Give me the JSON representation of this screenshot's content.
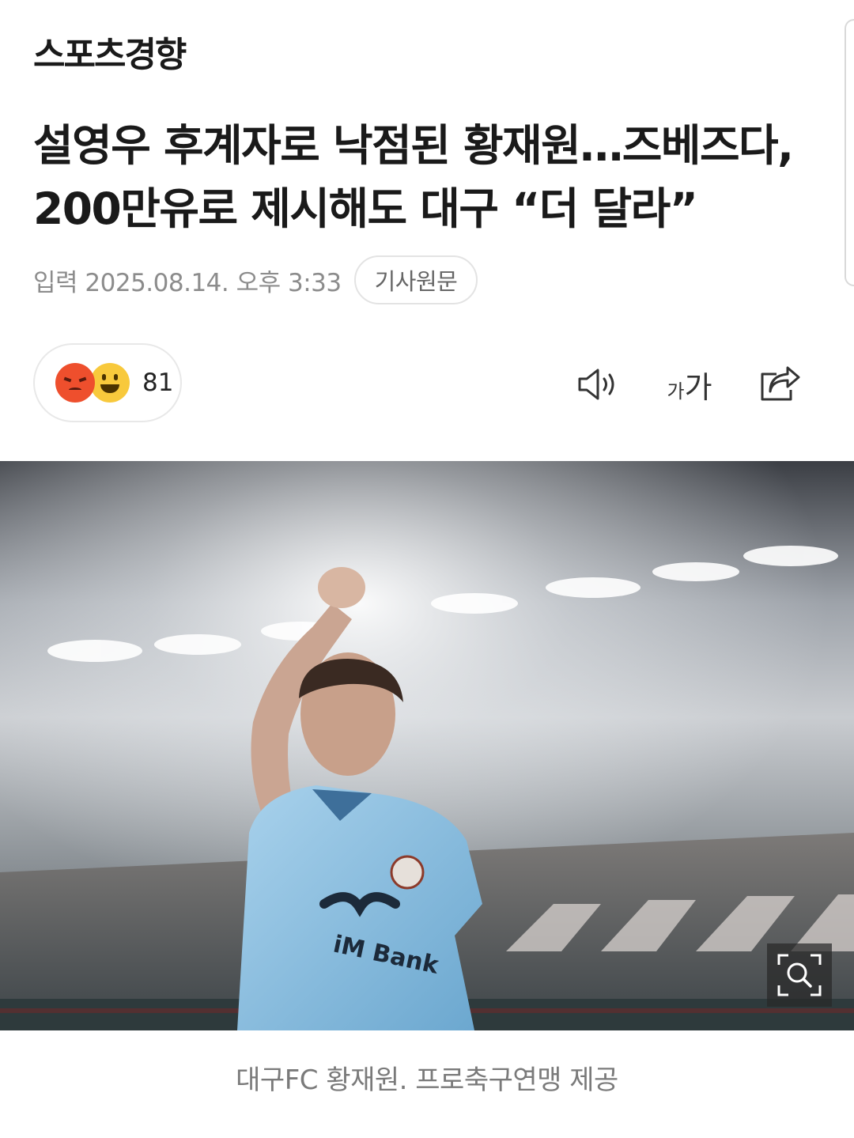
{
  "publisher": {
    "logo_text": "스포츠경향"
  },
  "article": {
    "headline": "설영우 후계자로 낙점된 황재원…즈베즈다, 200만유로 제시해도 대구 “더 달라”",
    "date_label": "입력 2025.08.14. 오후 3:33",
    "source_button": "기사원문"
  },
  "reactions": {
    "emojis": [
      "angry-emoji",
      "smile-emoji"
    ],
    "count": "81"
  },
  "toolbar": {
    "tts_icon": "speaker-icon",
    "font_small": "가",
    "font_large": "가",
    "share_icon": "share-icon"
  },
  "photo": {
    "zoom_icon": "zoom-search-icon",
    "jersey_text": "iM Bank",
    "caption": "대구FC 황재원. 프로축구연맹 제공"
  }
}
